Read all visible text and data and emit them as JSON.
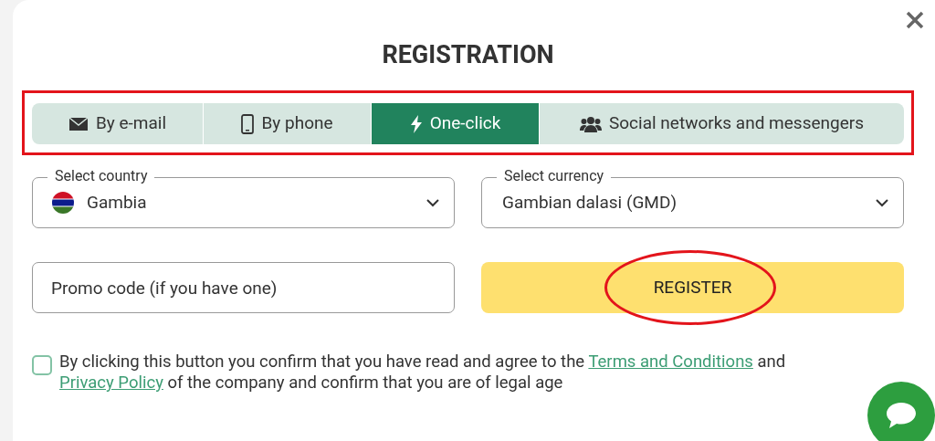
{
  "title": "REGISTRATION",
  "tabs": [
    {
      "label": "By e-mail",
      "kind": "mail",
      "selected": false
    },
    {
      "label": "By phone",
      "kind": "phone",
      "selected": false
    },
    {
      "label": "One-click",
      "kind": "bolt",
      "selected": true
    },
    {
      "label": "Social networks and messengers",
      "kind": "users",
      "selected": false
    }
  ],
  "country": {
    "label": "Select country",
    "value": "Gambia"
  },
  "currency": {
    "label": "Select currency",
    "value": "Gambian dalasi (GMD)"
  },
  "promo": {
    "placeholder": "Promo code (if you have one)"
  },
  "register_button": "REGISTER",
  "consent": {
    "checked": false,
    "text_before": "By clicking this button you confirm that you have read and agree to the",
    "link_terms": "Terms and Conditions",
    "text_mid": "and",
    "link_privacy": "Privacy Policy",
    "text_after": "of the company and confirm that you are of legal age"
  }
}
